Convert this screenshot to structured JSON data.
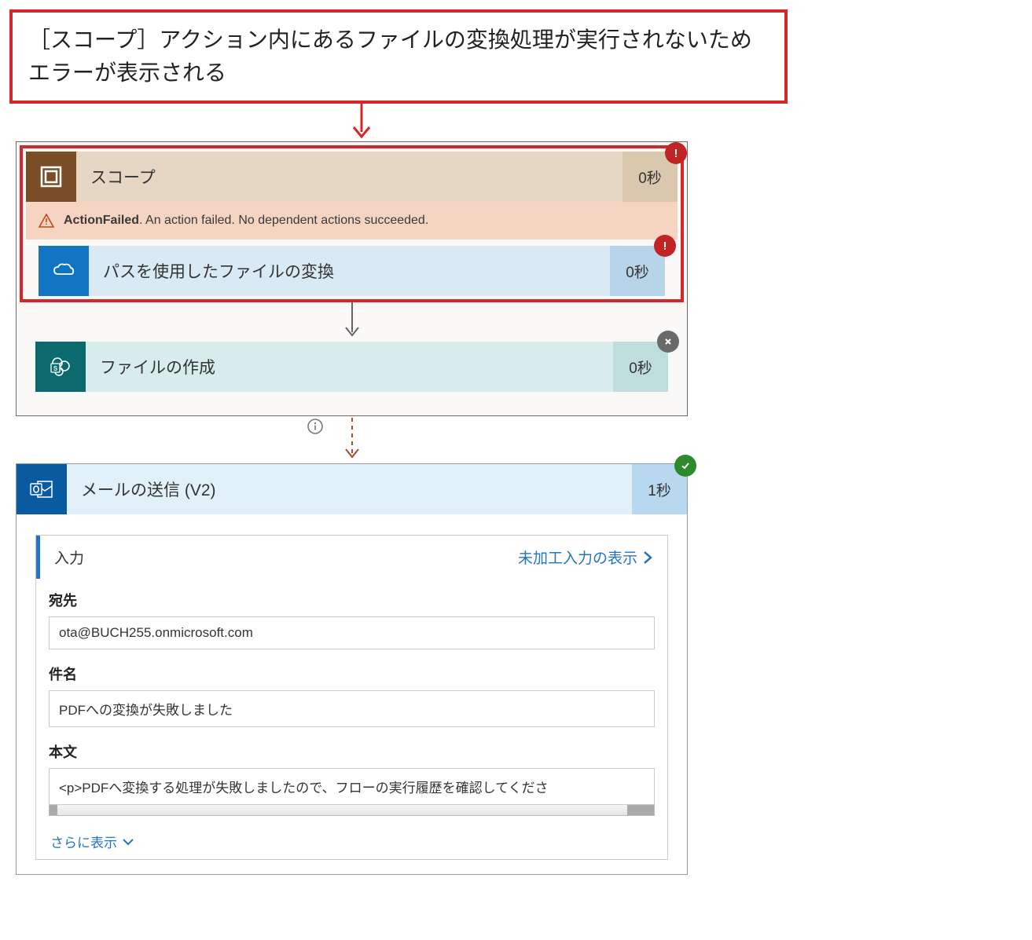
{
  "callout": {
    "text": "［スコープ］アクション内にあるファイルの変換処理が実行されないためエラーが表示される"
  },
  "scope": {
    "title": "スコープ",
    "duration": "0秒",
    "status": "error",
    "error": {
      "code": "ActionFailed",
      "message": ". An action failed. No dependent actions succeeded."
    },
    "actions": [
      {
        "id": "convert",
        "icon": "onedrive-icon",
        "title": "パスを使用したファイルの変換",
        "duration": "0秒",
        "status": "error"
      },
      {
        "id": "create",
        "icon": "sharepoint-icon",
        "title": "ファイルの作成",
        "duration": "0秒",
        "status": "skipped"
      }
    ]
  },
  "mail": {
    "icon": "outlook-icon",
    "title": "メールの送信 (V2)",
    "duration": "1秒",
    "status": "success",
    "inputs": {
      "header": "入力",
      "raw_link": "未加工入力の表示",
      "fields": {
        "to_label": "宛先",
        "to_value": "ota@BUCH255.onmicrosoft.com",
        "subject_label": "件名",
        "subject_value": "PDFへの変換が失敗しました",
        "body_label": "本文",
        "body_value": "<p>PDFへ変換する処理が失敗しましたので、フローの実行履歴を確認してくださ"
      },
      "show_more": "さらに表示"
    }
  }
}
